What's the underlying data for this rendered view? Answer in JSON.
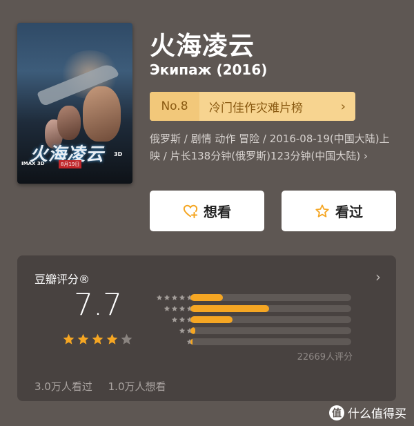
{
  "movie": {
    "title": "火海凌云",
    "subtitle": "Экипаж (2016)",
    "poster": {
      "title_text": "火海凌云",
      "format": "IMAX 3D",
      "date_badge": "8月19日",
      "dimension": "3D"
    }
  },
  "rank": {
    "number": "No.8",
    "label": "冷门佳作灾难片榜",
    "chevron": "›"
  },
  "meta": "俄罗斯 / 剧情 动作 冒险 / 2016-08-19(中国大陆)上映 / 片长138分钟(俄罗斯)123分钟(中国大陆) ›",
  "actions": {
    "want_label": "想看",
    "seen_label": "看过"
  },
  "rating": {
    "header": "豆瓣评分®",
    "score": "7.7",
    "stars_filled": 4,
    "stars_total": 5,
    "distribution": [
      {
        "stars": 5,
        "fraction": 0.2
      },
      {
        "stars": 4,
        "fraction": 0.49
      },
      {
        "stars": 3,
        "fraction": 0.26
      },
      {
        "stars": 2,
        "fraction": 0.03
      },
      {
        "stars": 1,
        "fraction": 0.01
      }
    ],
    "count": "22669人评分",
    "watched": "3.0万人看过",
    "wants": "1.0万人想看"
  },
  "watermark": {
    "logo_char": "值",
    "text": "什么值得买"
  },
  "colors": {
    "background": "#5e5753",
    "panel": "#484240",
    "accent": "#f5a623",
    "rank_bg": "#f7d490",
    "rank_text": "#8a5a12"
  }
}
